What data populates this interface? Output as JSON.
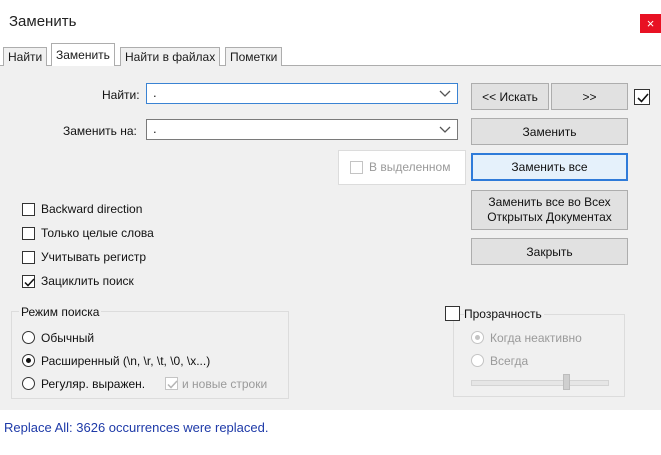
{
  "window": {
    "title": "Заменить",
    "close_icon": "×"
  },
  "tabs": [
    {
      "label": "Найти"
    },
    {
      "label": "Заменить"
    },
    {
      "label": "Найти в файлах"
    },
    {
      "label": "Пометки"
    }
  ],
  "find": {
    "label": "Найти:",
    "value": "."
  },
  "replace": {
    "label": "Заменить на:",
    "value": "."
  },
  "buttons": {
    "search_prev": "<< Искать",
    "search_next": ">>",
    "replace": "Заменить",
    "replace_all": "Заменить все",
    "replace_all_open_docs_line1": "Заменить все во Всех",
    "replace_all_open_docs_line2": "Открытых Документах",
    "close": "Закрыть"
  },
  "options": {
    "wrap_checkbox_checked": true,
    "in_selection": {
      "label": "В выделенном",
      "checked": false,
      "enabled": false
    },
    "backward_direction": {
      "label": "Backward direction",
      "checked": false
    },
    "whole_words": {
      "label": "Только целые слова",
      "checked": false
    },
    "match_case": {
      "label": "Учитывать регистр",
      "checked": false
    },
    "wrap_around": {
      "label": "Зациклить поиск",
      "checked": true
    }
  },
  "search_mode": {
    "title": "Режим поиска",
    "normal": "Обычный",
    "extended": "Расширенный (\\n, \\r, \\t, \\0, \\x...)",
    "regex": "Регуляр. выражен.",
    "newline_option": "и новые строки",
    "selected": "extended"
  },
  "transparency": {
    "label": "Прозрачность",
    "checked": false,
    "on_inactive": "Когда неактивно",
    "always": "Всегда",
    "level": 0.7
  },
  "status": {
    "text": "Replace All: 3626 occurrences were replaced."
  },
  "colors": {
    "status_text": "#1e3aa8",
    "close_button": "#e81123",
    "focus_blue": "#2f7bd9"
  }
}
